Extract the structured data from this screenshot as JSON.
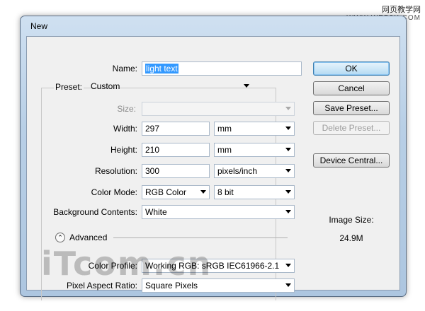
{
  "watermark": {
    "line1": "网页教学网",
    "line2": "WWW.WEB3X.COM"
  },
  "dialog": {
    "title": "New",
    "name": {
      "label": "Name:",
      "value": "light text"
    },
    "preset": {
      "label": "Preset:",
      "value": "Custom"
    },
    "size": {
      "label": "Size:",
      "value": ""
    },
    "width": {
      "label": "Width:",
      "value": "297",
      "unit": "mm"
    },
    "height": {
      "label": "Height:",
      "value": "210",
      "unit": "mm"
    },
    "resolution": {
      "label": "Resolution:",
      "value": "300",
      "unit": "pixels/inch"
    },
    "color_mode": {
      "label": "Color Mode:",
      "value": "RGB Color",
      "depth": "8 bit"
    },
    "background": {
      "label": "Background Contents:",
      "value": "White"
    },
    "advanced": {
      "label": "Advanced"
    },
    "color_profile": {
      "label": "Color Profile:",
      "value": "Working RGB:  sRGB IEC61966-2.1"
    },
    "pixel_aspect": {
      "label": "Pixel Aspect Ratio:",
      "value": "Square Pixels"
    },
    "buttons": {
      "ok": "OK",
      "cancel": "Cancel",
      "save_preset": "Save Preset...",
      "delete_preset": "Delete Preset...",
      "device_central": "Device Central..."
    },
    "image_size": {
      "label": "Image Size:",
      "value": "24.9M"
    }
  },
  "overlay_watermark": "iTcom.cn"
}
